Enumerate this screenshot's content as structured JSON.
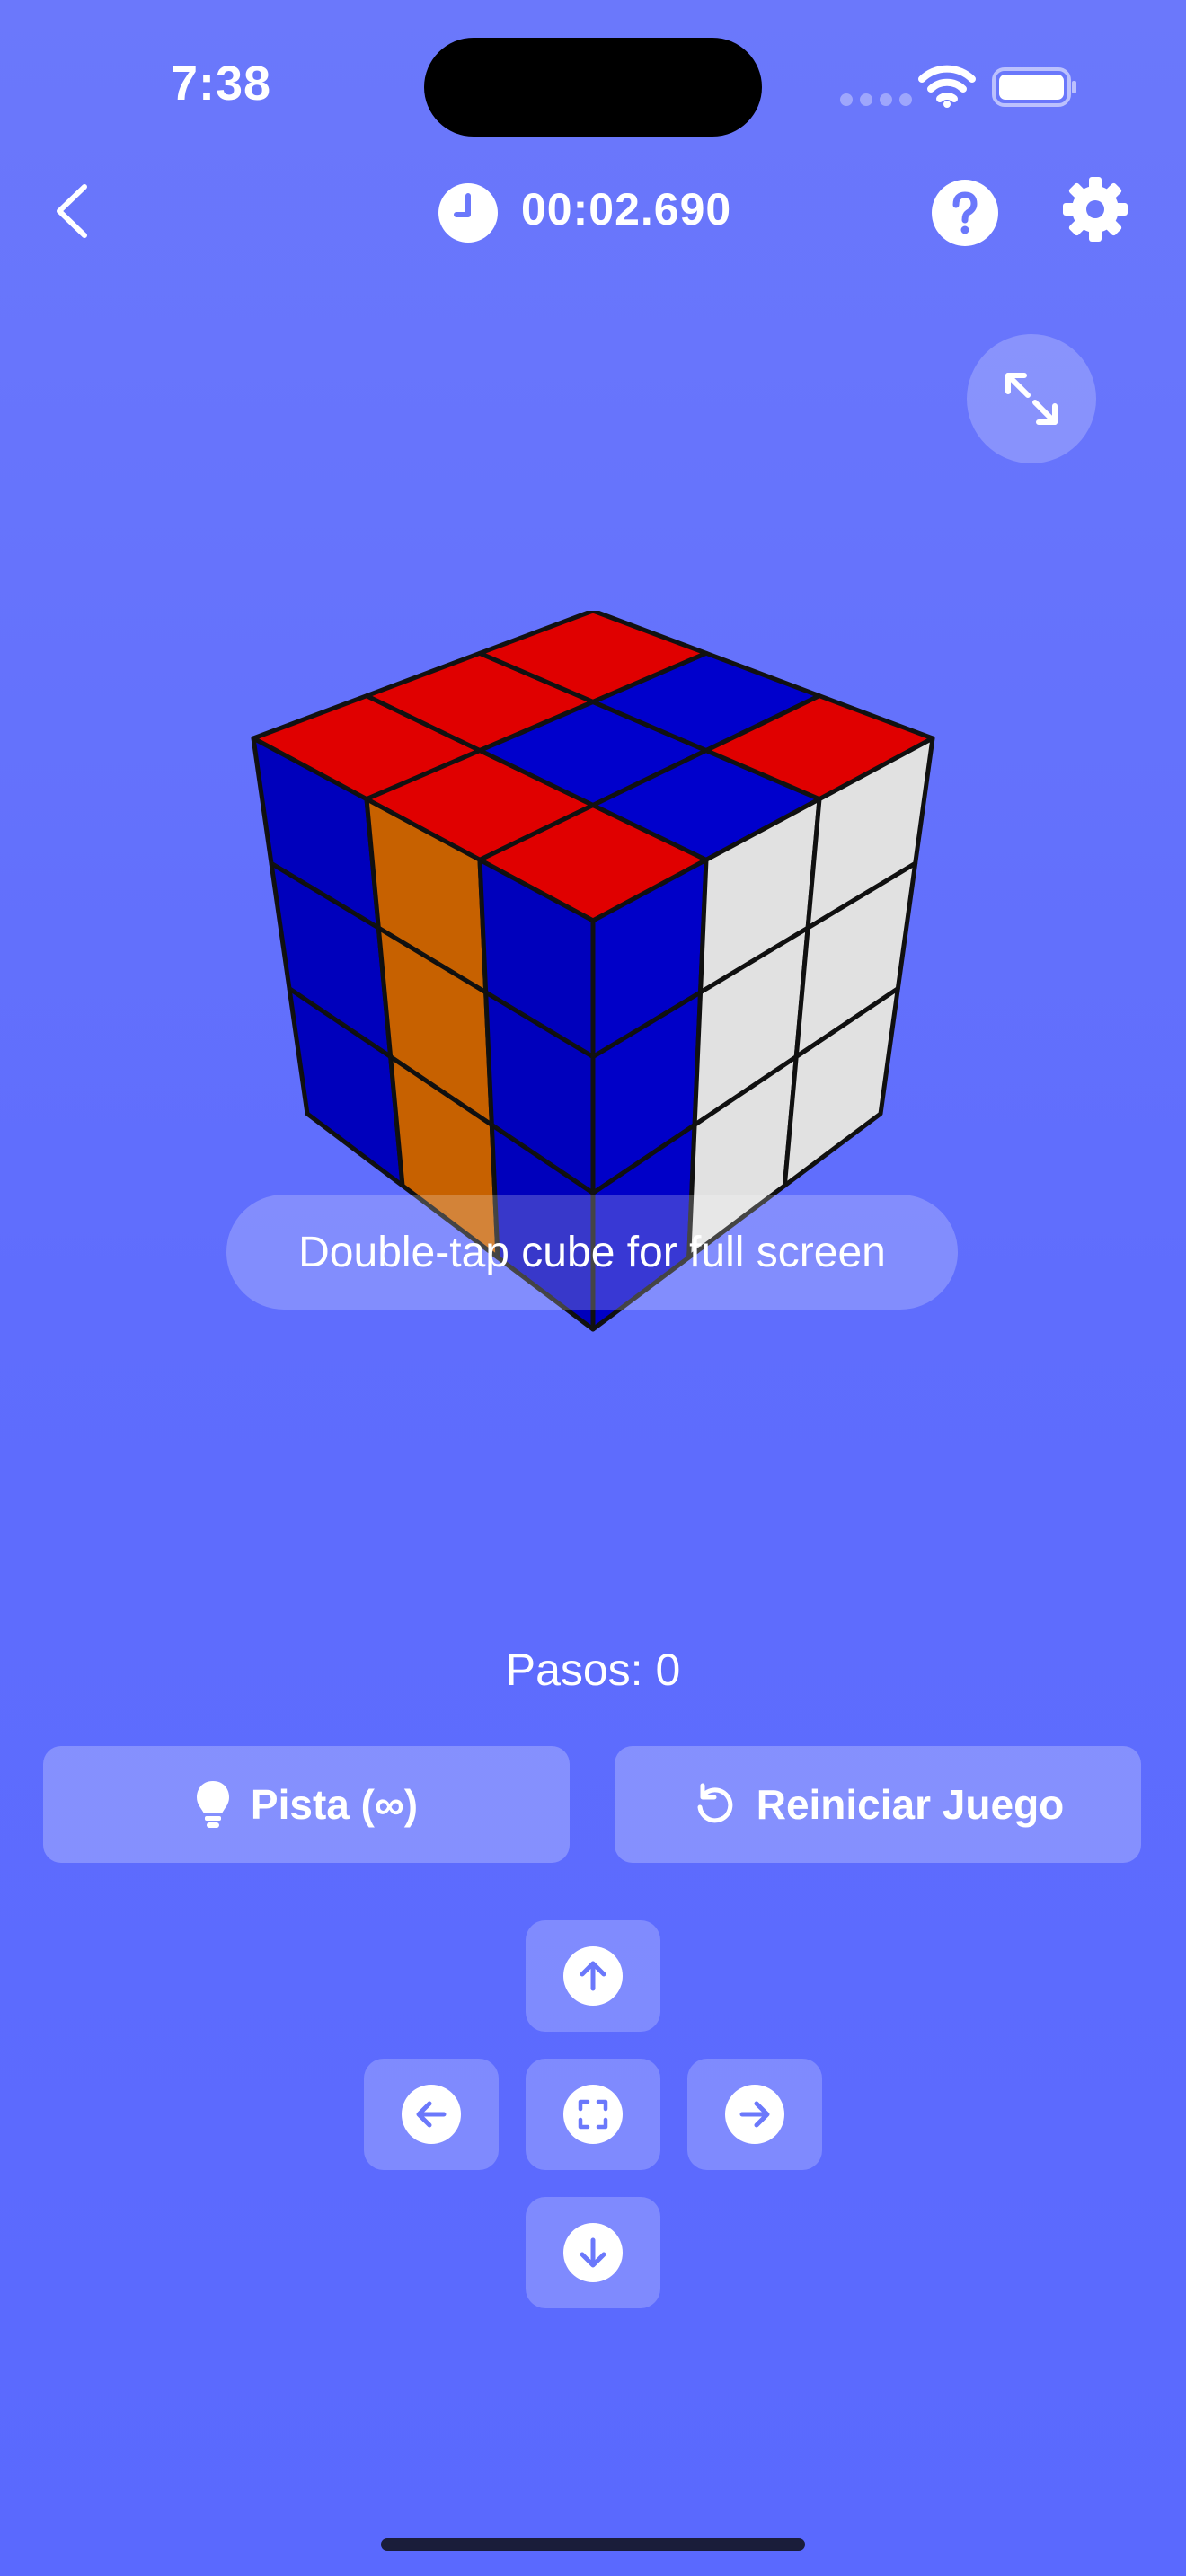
{
  "status_bar": {
    "time": "7:38"
  },
  "header": {
    "back_icon": "chevron-left-icon",
    "timer_icon": "clock-icon",
    "timer": "00:02.690",
    "help_icon": "question-circle-icon",
    "settings_icon": "gear-icon"
  },
  "fullscreen_icon": "expand-arrows-icon",
  "cube": {
    "faces": {
      "top": [
        [
          "red",
          "red",
          "red"
        ],
        [
          "red",
          "blue",
          "blue"
        ],
        [
          "red",
          "blue",
          "red"
        ]
      ],
      "front": [
        [
          "blue",
          "white",
          "white"
        ],
        [
          "blue",
          "white",
          "white"
        ],
        [
          "blue",
          "white",
          "white"
        ]
      ],
      "left": [
        [
          "blue",
          "orange",
          "blue"
        ],
        [
          "blue",
          "orange",
          "blue"
        ],
        [
          "blue",
          "orange",
          "blue"
        ]
      ]
    },
    "colors": {
      "red": "#e00000",
      "blue": "#0000cc",
      "white": "#e6e6e6",
      "orange": "#d86a00"
    }
  },
  "tap_hint": "Double-tap cube for full screen",
  "steps_label": "Pasos: 0",
  "buttons": {
    "hint": "Pista (∞)",
    "hint_icon": "lightbulb-icon",
    "reset": "Reiniciar Juego",
    "reset_icon": "rotate-ccw-icon"
  },
  "dpad": {
    "up_icon": "arrow-up-icon",
    "left_icon": "arrow-left-icon",
    "center_icon": "focus-frame-icon",
    "right_icon": "arrow-right-icon",
    "down_icon": "arrow-down-icon"
  },
  "theme": {
    "background": "#6272fc",
    "accent_icon": "#6b78fb"
  }
}
